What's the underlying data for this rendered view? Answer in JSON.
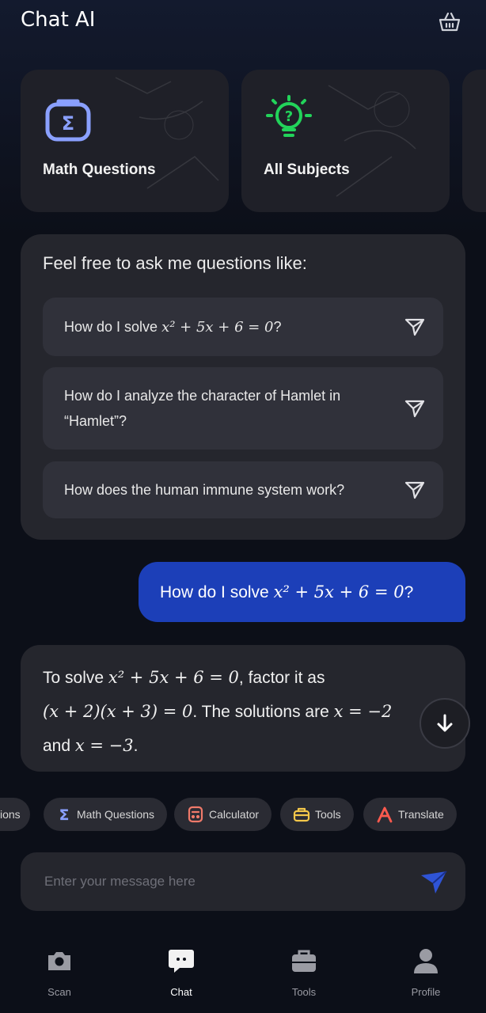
{
  "app_title": "Chat AI",
  "cards": [
    {
      "label": "Math Questions",
      "icon": "sigma-icon"
    },
    {
      "label": "All Subjects",
      "icon": "lightbulb-question-icon"
    }
  ],
  "suggestions": {
    "heading": "Feel free to ask me questions like:",
    "items": [
      {
        "prefix": "How do I solve ",
        "math": "x² + 5x + 6 = 0",
        "suffix": "?"
      },
      {
        "prefix": "How do I analyze the character of Hamlet in “Hamlet”?",
        "math": "",
        "suffix": ""
      },
      {
        "prefix": "How does the human immune system work?",
        "math": "",
        "suffix": ""
      }
    ]
  },
  "user_message": {
    "prefix": "How do I solve ",
    "math": "x² + 5x + 6 = 0",
    "suffix": "?"
  },
  "ai_message": {
    "line1_prefix": "To solve ",
    "line1_math": "x² + 5x + 6 = 0",
    "line1_suffix": ", factor it as",
    "line2_math": "(x + 2)(x + 3) = 0",
    "line2_text": ". The solutions are ",
    "line2_math_b": "x = −2",
    "line3_text": "and ",
    "line3_math": "x = −3",
    "line3_suffix": "."
  },
  "chips": [
    {
      "label": "ions",
      "icon": ""
    },
    {
      "label": "Math Questions",
      "icon": "sigma-icon"
    },
    {
      "label": "Calculator",
      "icon": "calculator-icon"
    },
    {
      "label": "Tools",
      "icon": "toolbox-icon"
    },
    {
      "label": "Translate",
      "icon": "translate-icon"
    }
  ],
  "input": {
    "placeholder": "Enter your message here"
  },
  "nav": [
    {
      "label": "Scan",
      "icon": "camera-icon"
    },
    {
      "label": "Chat",
      "icon": "chat-icon",
      "active": true
    },
    {
      "label": "Tools",
      "icon": "briefcase-icon"
    },
    {
      "label": "Profile",
      "icon": "person-icon"
    }
  ],
  "colors": {
    "accent_blue": "#1c3fb8",
    "sigma_blue": "#8aa0ff",
    "bulb_green": "#22d35a",
    "calculator_red": "#f07a6a",
    "toolbox_yellow": "#f3c74a",
    "translate_red": "#ff5a4e"
  }
}
